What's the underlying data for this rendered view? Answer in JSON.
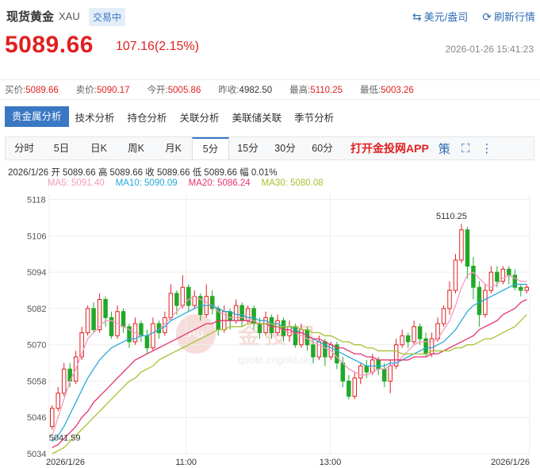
{
  "header": {
    "name": "现货黄金",
    "code": "XAU",
    "status": "交易中",
    "currency_toggle": "美元/盎司",
    "refresh": "刷新行情",
    "price": "5089.66",
    "change": "107.16(2.15%)",
    "datetime": "2026-01-26 15:41:23"
  },
  "quotes": [
    {
      "label": "买价:",
      "value": "5089.66",
      "color": "red"
    },
    {
      "label": "卖价:",
      "value": "5090.17",
      "color": "red"
    },
    {
      "label": "今开:",
      "value": "5005.86",
      "color": "red"
    },
    {
      "label": "昨收:",
      "value": "4982.50",
      "color": "black"
    },
    {
      "label": "最高:",
      "value": "5110.25",
      "color": "red"
    },
    {
      "label": "最低:",
      "value": "5003.26",
      "color": "red"
    }
  ],
  "analysis_tabs": [
    "贵金属分析",
    "技术分析",
    "持仓分析",
    "关联分析",
    "美联储关联",
    "季节分析"
  ],
  "period_tabs": [
    "分时",
    "5日",
    "日K",
    "周K",
    "月K",
    "5分",
    "15分",
    "30分",
    "60分"
  ],
  "active_period": "5分",
  "app_link": "打开金投网APP",
  "icons": {
    "currency": "swap-arrows-icon",
    "refresh": "refresh-icon",
    "strategy": "策",
    "fullscreen": "fullscreen-icon",
    "more": "more-vertical-icon"
  },
  "bar_info": "2026/1/26  开 5089.66  高 5089.66  收 5089.66  低 5089.66  幅 0.01%",
  "ma_legend": [
    {
      "label": "MA5: 5091.40",
      "color": "#f39bbf"
    },
    {
      "label": "MA10: 5090.09",
      "color": "#29a9d8"
    },
    {
      "label": "MA20: 5086.24",
      "color": "#e5336f"
    },
    {
      "label": "MA30: 5080.08",
      "color": "#a4c232"
    }
  ],
  "watermark": {
    "mark": "Au",
    "title": "金投网",
    "url": "quote.cngold.org"
  },
  "chart_data": {
    "type": "candlestick",
    "y_ticks": [
      5034,
      5046,
      5058,
      5070,
      5082,
      5094,
      5106,
      5118
    ],
    "ylim": [
      5034,
      5120
    ],
    "x_labels": [
      "2026/1/26",
      "11:00",
      "13:00",
      "2026/1/26"
    ],
    "high_label": "5110.25",
    "low_label": "5041.59",
    "up_color": "#e02020",
    "down_color": "#21a829",
    "candles": [
      [
        5043,
        5049,
        5042,
        5050
      ],
      [
        5049,
        5054,
        5048,
        5056
      ],
      [
        5054,
        5062,
        5053,
        5064
      ],
      [
        5062,
        5058,
        5056,
        5064
      ],
      [
        5058,
        5066,
        5057,
        5068
      ],
      [
        5066,
        5074,
        5065,
        5076
      ],
      [
        5074,
        5082,
        5073,
        5083
      ],
      [
        5082,
        5075,
        5074,
        5084
      ],
      [
        5075,
        5085,
        5074,
        5087
      ],
      [
        5085,
        5079,
        5076,
        5086
      ],
      [
        5079,
        5073,
        5072,
        5081
      ],
      [
        5073,
        5081,
        5072,
        5083
      ],
      [
        5081,
        5076,
        5074,
        5082
      ],
      [
        5076,
        5071,
        5069,
        5077
      ],
      [
        5071,
        5077,
        5070,
        5079
      ],
      [
        5077,
        5073,
        5071,
        5078
      ],
      [
        5073,
        5069,
        5067,
        5075
      ],
      [
        5069,
        5077,
        5068,
        5079
      ],
      [
        5077,
        5074,
        5072,
        5078
      ],
      [
        5074,
        5079,
        5073,
        5081
      ],
      [
        5079,
        5087,
        5078,
        5090
      ],
      [
        5087,
        5083,
        5080,
        5088
      ],
      [
        5083,
        5089,
        5082,
        5093
      ],
      [
        5089,
        5083,
        5081,
        5090
      ],
      [
        5083,
        5086,
        5082,
        5088
      ],
      [
        5086,
        5080,
        5078,
        5087
      ],
      [
        5080,
        5086,
        5079,
        5090
      ],
      [
        5086,
        5082,
        5080,
        5088
      ],
      [
        5082,
        5075,
        5073,
        5083
      ],
      [
        5075,
        5081,
        5074,
        5083
      ],
      [
        5081,
        5078,
        5075,
        5082
      ],
      [
        5078,
        5083,
        5077,
        5085
      ],
      [
        5083,
        5078,
        5076,
        5084
      ],
      [
        5078,
        5082,
        5077,
        5083
      ],
      [
        5082,
        5077,
        5075,
        5083
      ],
      [
        5077,
        5074,
        5072,
        5079
      ],
      [
        5074,
        5079,
        5073,
        5081
      ],
      [
        5079,
        5074,
        5072,
        5080
      ],
      [
        5074,
        5078,
        5073,
        5080
      ],
      [
        5078,
        5073,
        5071,
        5079
      ],
      [
        5073,
        5076,
        5071,
        5078
      ],
      [
        5076,
        5070,
        5069,
        5077
      ],
      [
        5070,
        5075,
        5069,
        5077
      ],
      [
        5075,
        5070,
        5068,
        5076
      ],
      [
        5070,
        5066,
        5064,
        5072
      ],
      [
        5066,
        5071,
        5065,
        5073
      ],
      [
        5071,
        5066,
        5063,
        5072
      ],
      [
        5066,
        5070,
        5065,
        5071
      ],
      [
        5070,
        5064,
        5062,
        5071
      ],
      [
        5064,
        5058,
        5056,
        5066
      ],
      [
        5058,
        5053,
        5052,
        5060
      ],
      [
        5053,
        5059,
        5052,
        5061
      ],
      [
        5059,
        5063,
        5057,
        5064
      ],
      [
        5063,
        5061,
        5059,
        5065
      ],
      [
        5061,
        5065,
        5060,
        5067
      ],
      [
        5065,
        5062,
        5060,
        5066
      ],
      [
        5062,
        5058,
        5056,
        5064
      ],
      [
        5058,
        5063,
        5054,
        5065
      ],
      [
        5063,
        5070,
        5062,
        5072
      ],
      [
        5070,
        5073,
        5069,
        5075
      ],
      [
        5073,
        5071,
        5069,
        5074
      ],
      [
        5071,
        5076,
        5070,
        5078
      ],
      [
        5076,
        5072,
        5070,
        5077
      ],
      [
        5072,
        5067,
        5066,
        5074
      ],
      [
        5067,
        5072,
        5066,
        5074
      ],
      [
        5072,
        5077,
        5071,
        5079
      ],
      [
        5077,
        5082,
        5076,
        5083
      ],
      [
        5082,
        5088,
        5080,
        5091
      ],
      [
        5088,
        5098,
        5087,
        5100
      ],
      [
        5098,
        5108,
        5097,
        5110
      ],
      [
        5108,
        5096,
        5092,
        5109
      ],
      [
        5096,
        5089,
        5085,
        5099
      ],
      [
        5089,
        5080,
        5076,
        5091
      ],
      [
        5080,
        5088,
        5079,
        5090
      ],
      [
        5088,
        5094,
        5087,
        5096
      ],
      [
        5094,
        5091,
        5089,
        5096
      ],
      [
        5091,
        5095,
        5090,
        5096
      ],
      [
        5095,
        5093,
        5090,
        5096
      ],
      [
        5093,
        5089,
        5088,
        5095
      ],
      [
        5089,
        5088,
        5086,
        5090
      ],
      [
        5088,
        5089,
        5087,
        5090
      ]
    ],
    "series": [
      {
        "name": "MA5",
        "values": [
          5040,
          5046,
          5052,
          5058,
          5062,
          5067,
          5072,
          5074,
          5076,
          5078,
          5078,
          5077,
          5076,
          5075,
          5074,
          5073,
          5073,
          5074,
          5075,
          5077,
          5079,
          5081,
          5083,
          5085,
          5086,
          5085,
          5084,
          5083,
          5081,
          5080,
          5079,
          5079,
          5079,
          5079,
          5078,
          5077,
          5077,
          5076,
          5076,
          5075,
          5074,
          5074,
          5073,
          5072,
          5071,
          5070,
          5069,
          5068,
          5066,
          5064,
          5062,
          5061,
          5060,
          5060,
          5061,
          5062,
          5062,
          5063,
          5064,
          5066,
          5068,
          5070,
          5071,
          5071,
          5071,
          5072,
          5075,
          5078,
          5083,
          5089,
          5093,
          5094,
          5092,
          5090,
          5089,
          5090,
          5092,
          5093,
          5092,
          5091,
          5091
        ]
      },
      {
        "name": "MA10",
        "values": [
          5038,
          5040,
          5043,
          5047,
          5051,
          5055,
          5059,
          5062,
          5065,
          5067,
          5069,
          5070,
          5071,
          5072,
          5072,
          5073,
          5073,
          5074,
          5075,
          5076,
          5078,
          5079,
          5080,
          5081,
          5082,
          5083,
          5083,
          5083,
          5082,
          5081,
          5081,
          5080,
          5080,
          5079,
          5079,
          5078,
          5078,
          5077,
          5077,
          5076,
          5076,
          5075,
          5074,
          5073,
          5072,
          5071,
          5070,
          5069,
          5068,
          5067,
          5066,
          5065,
          5064,
          5063,
          5063,
          5063,
          5063,
          5064,
          5064,
          5065,
          5066,
          5067,
          5068,
          5069,
          5069,
          5070,
          5071,
          5073,
          5075,
          5078,
          5081,
          5083,
          5084,
          5085,
          5086,
          5087,
          5088,
          5089,
          5090,
          5090,
          5090
        ]
      },
      {
        "name": "MA20",
        "values": [
          5036,
          5037,
          5039,
          5041,
          5043,
          5046,
          5048,
          5051,
          5053,
          5055,
          5057,
          5059,
          5061,
          5063,
          5065,
          5066,
          5067,
          5068,
          5069,
          5070,
          5071,
          5072,
          5073,
          5074,
          5075,
          5076,
          5077,
          5077,
          5078,
          5078,
          5078,
          5078,
          5078,
          5078,
          5077,
          5077,
          5077,
          5076,
          5076,
          5075,
          5075,
          5074,
          5074,
          5073,
          5072,
          5072,
          5071,
          5070,
          5069,
          5069,
          5068,
          5067,
          5067,
          5066,
          5066,
          5065,
          5065,
          5065,
          5065,
          5065,
          5065,
          5066,
          5066,
          5066,
          5067,
          5067,
          5068,
          5069,
          5070,
          5071,
          5072,
          5073,
          5075,
          5076,
          5077,
          5078,
          5080,
          5081,
          5082,
          5084,
          5085
        ]
      },
      {
        "name": "MA30",
        "values": [
          5034,
          5035,
          5036,
          5038,
          5040,
          5042,
          5044,
          5046,
          5048,
          5050,
          5052,
          5054,
          5056,
          5058,
          5059,
          5061,
          5062,
          5063,
          5065,
          5066,
          5067,
          5068,
          5069,
          5070,
          5071,
          5072,
          5073,
          5074,
          5075,
          5075,
          5076,
          5076,
          5076,
          5077,
          5077,
          5077,
          5077,
          5077,
          5076,
          5076,
          5076,
          5076,
          5075,
          5075,
          5074,
          5074,
          5073,
          5073,
          5072,
          5071,
          5071,
          5070,
          5070,
          5069,
          5069,
          5068,
          5068,
          5068,
          5068,
          5067,
          5067,
          5067,
          5067,
          5067,
          5068,
          5068,
          5068,
          5068,
          5069,
          5069,
          5070,
          5070,
          5071,
          5072,
          5072,
          5073,
          5074,
          5075,
          5076,
          5078,
          5080
        ]
      }
    ]
  }
}
